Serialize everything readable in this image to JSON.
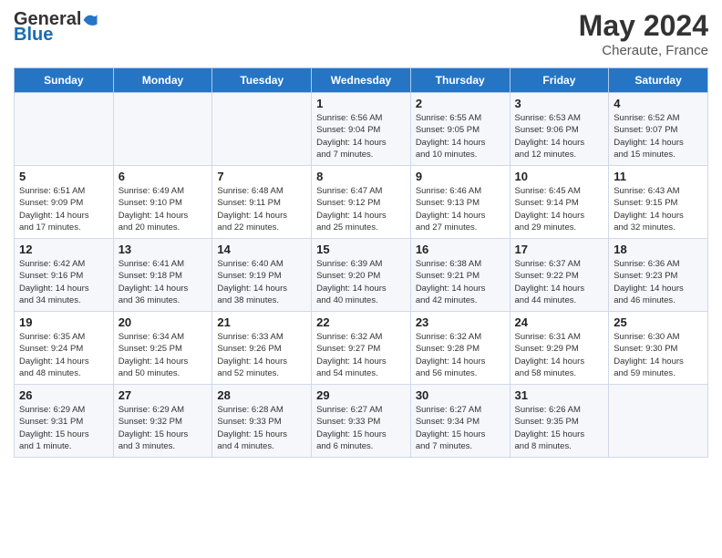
{
  "header": {
    "logo_general": "General",
    "logo_blue": "Blue",
    "month_year": "May 2024",
    "location": "Cheraute, France"
  },
  "days_of_week": [
    "Sunday",
    "Monday",
    "Tuesday",
    "Wednesday",
    "Thursday",
    "Friday",
    "Saturday"
  ],
  "weeks": [
    [
      {
        "day": "",
        "info": ""
      },
      {
        "day": "",
        "info": ""
      },
      {
        "day": "",
        "info": ""
      },
      {
        "day": "1",
        "info": "Sunrise: 6:56 AM\nSunset: 9:04 PM\nDaylight: 14 hours\nand 7 minutes."
      },
      {
        "day": "2",
        "info": "Sunrise: 6:55 AM\nSunset: 9:05 PM\nDaylight: 14 hours\nand 10 minutes."
      },
      {
        "day": "3",
        "info": "Sunrise: 6:53 AM\nSunset: 9:06 PM\nDaylight: 14 hours\nand 12 minutes."
      },
      {
        "day": "4",
        "info": "Sunrise: 6:52 AM\nSunset: 9:07 PM\nDaylight: 14 hours\nand 15 minutes."
      }
    ],
    [
      {
        "day": "5",
        "info": "Sunrise: 6:51 AM\nSunset: 9:09 PM\nDaylight: 14 hours\nand 17 minutes."
      },
      {
        "day": "6",
        "info": "Sunrise: 6:49 AM\nSunset: 9:10 PM\nDaylight: 14 hours\nand 20 minutes."
      },
      {
        "day": "7",
        "info": "Sunrise: 6:48 AM\nSunset: 9:11 PM\nDaylight: 14 hours\nand 22 minutes."
      },
      {
        "day": "8",
        "info": "Sunrise: 6:47 AM\nSunset: 9:12 PM\nDaylight: 14 hours\nand 25 minutes."
      },
      {
        "day": "9",
        "info": "Sunrise: 6:46 AM\nSunset: 9:13 PM\nDaylight: 14 hours\nand 27 minutes."
      },
      {
        "day": "10",
        "info": "Sunrise: 6:45 AM\nSunset: 9:14 PM\nDaylight: 14 hours\nand 29 minutes."
      },
      {
        "day": "11",
        "info": "Sunrise: 6:43 AM\nSunset: 9:15 PM\nDaylight: 14 hours\nand 32 minutes."
      }
    ],
    [
      {
        "day": "12",
        "info": "Sunrise: 6:42 AM\nSunset: 9:16 PM\nDaylight: 14 hours\nand 34 minutes."
      },
      {
        "day": "13",
        "info": "Sunrise: 6:41 AM\nSunset: 9:18 PM\nDaylight: 14 hours\nand 36 minutes."
      },
      {
        "day": "14",
        "info": "Sunrise: 6:40 AM\nSunset: 9:19 PM\nDaylight: 14 hours\nand 38 minutes."
      },
      {
        "day": "15",
        "info": "Sunrise: 6:39 AM\nSunset: 9:20 PM\nDaylight: 14 hours\nand 40 minutes."
      },
      {
        "day": "16",
        "info": "Sunrise: 6:38 AM\nSunset: 9:21 PM\nDaylight: 14 hours\nand 42 minutes."
      },
      {
        "day": "17",
        "info": "Sunrise: 6:37 AM\nSunset: 9:22 PM\nDaylight: 14 hours\nand 44 minutes."
      },
      {
        "day": "18",
        "info": "Sunrise: 6:36 AM\nSunset: 9:23 PM\nDaylight: 14 hours\nand 46 minutes."
      }
    ],
    [
      {
        "day": "19",
        "info": "Sunrise: 6:35 AM\nSunset: 9:24 PM\nDaylight: 14 hours\nand 48 minutes."
      },
      {
        "day": "20",
        "info": "Sunrise: 6:34 AM\nSunset: 9:25 PM\nDaylight: 14 hours\nand 50 minutes."
      },
      {
        "day": "21",
        "info": "Sunrise: 6:33 AM\nSunset: 9:26 PM\nDaylight: 14 hours\nand 52 minutes."
      },
      {
        "day": "22",
        "info": "Sunrise: 6:32 AM\nSunset: 9:27 PM\nDaylight: 14 hours\nand 54 minutes."
      },
      {
        "day": "23",
        "info": "Sunrise: 6:32 AM\nSunset: 9:28 PM\nDaylight: 14 hours\nand 56 minutes."
      },
      {
        "day": "24",
        "info": "Sunrise: 6:31 AM\nSunset: 9:29 PM\nDaylight: 14 hours\nand 58 minutes."
      },
      {
        "day": "25",
        "info": "Sunrise: 6:30 AM\nSunset: 9:30 PM\nDaylight: 14 hours\nand 59 minutes."
      }
    ],
    [
      {
        "day": "26",
        "info": "Sunrise: 6:29 AM\nSunset: 9:31 PM\nDaylight: 15 hours\nand 1 minute."
      },
      {
        "day": "27",
        "info": "Sunrise: 6:29 AM\nSunset: 9:32 PM\nDaylight: 15 hours\nand 3 minutes."
      },
      {
        "day": "28",
        "info": "Sunrise: 6:28 AM\nSunset: 9:33 PM\nDaylight: 15 hours\nand 4 minutes."
      },
      {
        "day": "29",
        "info": "Sunrise: 6:27 AM\nSunset: 9:33 PM\nDaylight: 15 hours\nand 6 minutes."
      },
      {
        "day": "30",
        "info": "Sunrise: 6:27 AM\nSunset: 9:34 PM\nDaylight: 15 hours\nand 7 minutes."
      },
      {
        "day": "31",
        "info": "Sunrise: 6:26 AM\nSunset: 9:35 PM\nDaylight: 15 hours\nand 8 minutes."
      },
      {
        "day": "",
        "info": ""
      }
    ]
  ]
}
